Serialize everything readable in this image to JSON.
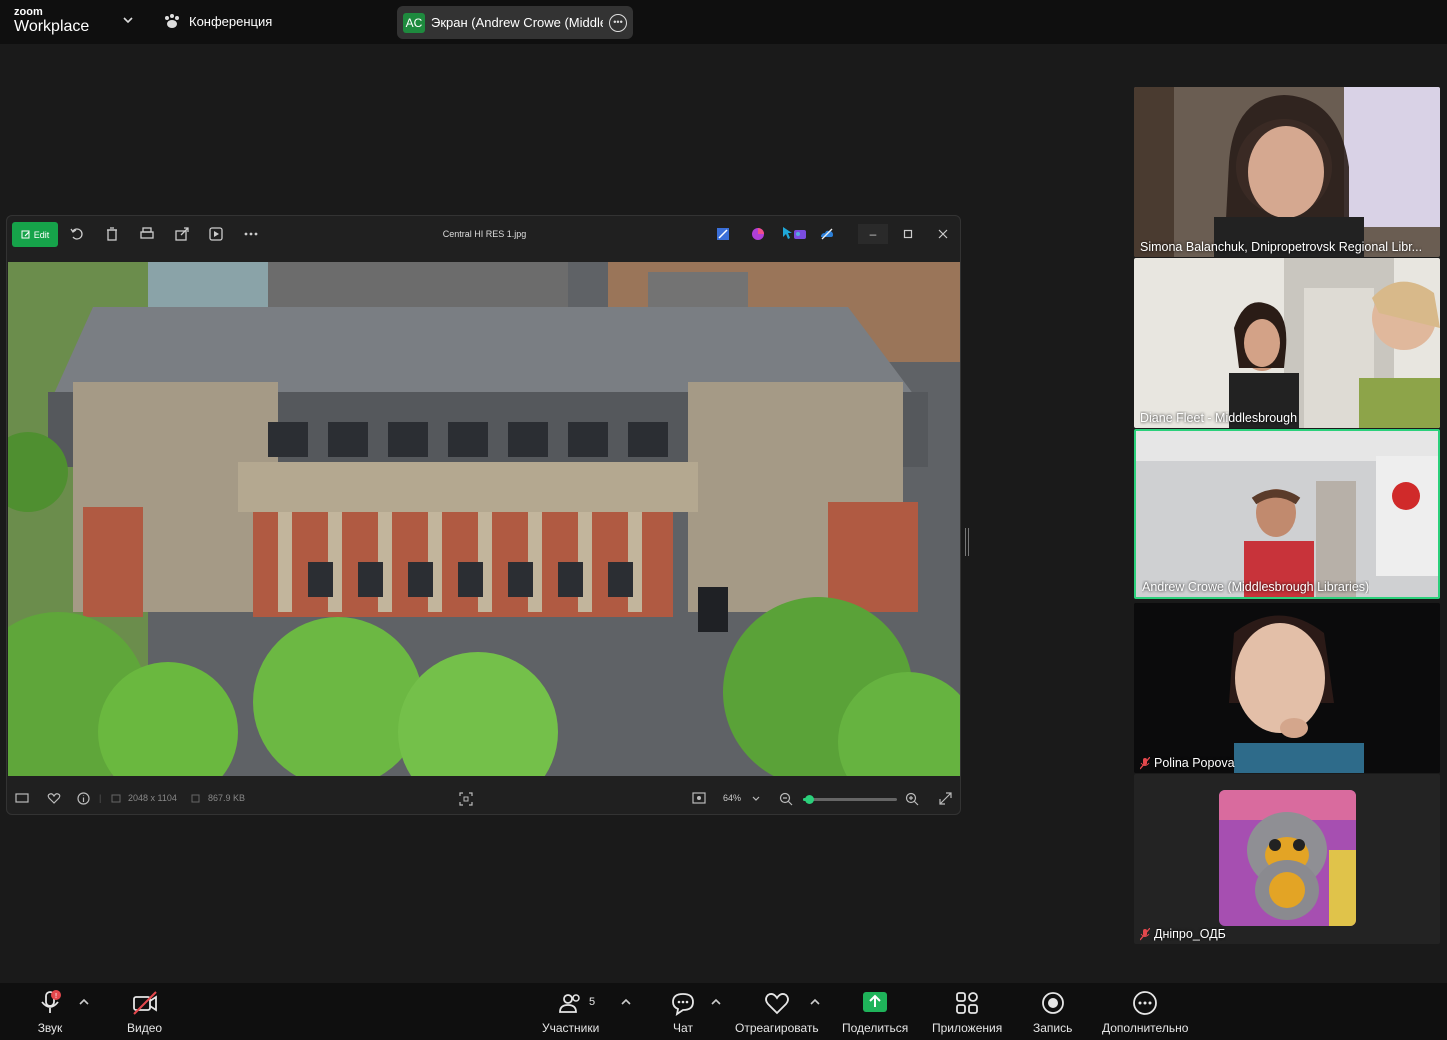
{
  "topbar": {
    "logo_small": "zoom",
    "logo_big": "Workplace",
    "conference_label": "Конференция",
    "screen_initials": "AC",
    "screen_label": "Экран (Andrew Crowe (Middlesb"
  },
  "viewer": {
    "edit_label": "Edit",
    "file_title": "Central HI RES 1.jpg",
    "dimensions": "2048 x 1104",
    "file_size": "867.9 KB",
    "zoom_value": "64%",
    "zoom_level": 0.06
  },
  "participants": [
    {
      "name": "Simona Balanchuk, Dnipropetrovsk Regional Libr...",
      "muted": false
    },
    {
      "name": "Diane Fleet - Middlesbrough",
      "muted": false
    },
    {
      "name": "Andrew Crowe (Middlesbrough Libraries)",
      "muted": false,
      "active_speaker": true
    },
    {
      "name": "Polina Popova",
      "muted": true
    },
    {
      "name": "Дніпро_ОДБ",
      "muted": true
    }
  ],
  "bottombar": {
    "audio": "Звук",
    "video": "Видео",
    "participants": "Участники",
    "participants_count": "5",
    "chat": "Чат",
    "react": "Отреагировать",
    "share": "Поделиться",
    "apps": "Приложения",
    "record": "Запись",
    "more": "Дополнительно"
  },
  "colors": {
    "accent_green": "#16a34a",
    "active_speaker_border": "#2bd07b",
    "share_green": "#1fb35a",
    "mute_red": "#e5484d"
  }
}
